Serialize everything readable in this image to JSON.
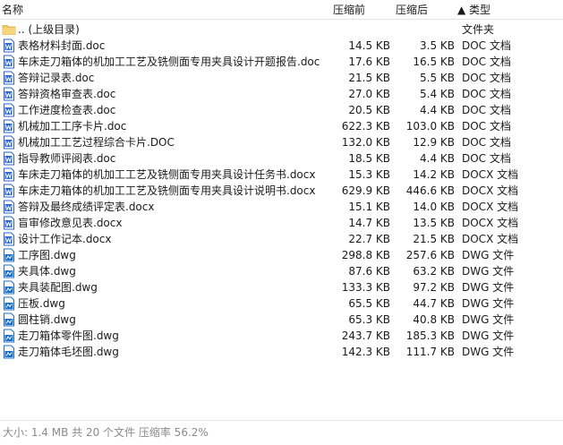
{
  "header": {
    "name": "名称",
    "size": "压缩前",
    "packed": "压缩后",
    "type": "▲ 类型"
  },
  "rows": [
    {
      "icon": "folder-icon",
      "name": ".. (上级目录)",
      "size": "",
      "packed": "",
      "type": "文件夹"
    },
    {
      "icon": "word-doc-icon",
      "name": "表格材料封面.doc",
      "size": "14.5 KB",
      "packed": "3.5 KB",
      "type": "DOC 文档"
    },
    {
      "icon": "word-doc-icon",
      "name": "车床走刀箱体的机加工工艺及铣侧面专用夹具设计开题报告.doc",
      "size": "17.6 KB",
      "packed": "16.5 KB",
      "type": "DOC 文档"
    },
    {
      "icon": "word-doc-icon",
      "name": "答辩记录表.doc",
      "size": "21.5 KB",
      "packed": "5.5 KB",
      "type": "DOC 文档"
    },
    {
      "icon": "word-doc-icon",
      "name": "答辩资格审查表.doc",
      "size": "27.0 KB",
      "packed": "5.4 KB",
      "type": "DOC 文档"
    },
    {
      "icon": "word-doc-icon",
      "name": "工作进度检查表.doc",
      "size": "20.5 KB",
      "packed": "4.4 KB",
      "type": "DOC 文档"
    },
    {
      "icon": "word-doc-icon",
      "name": "机械加工工序卡片.doc",
      "size": "622.3 KB",
      "packed": "103.0 KB",
      "type": "DOC 文档"
    },
    {
      "icon": "word-doc-icon",
      "name": "机械加工工艺过程综合卡片.DOC",
      "size": "132.0 KB",
      "packed": "12.9 KB",
      "type": "DOC 文档"
    },
    {
      "icon": "word-doc-icon",
      "name": "指导教师评阅表.doc",
      "size": "18.5 KB",
      "packed": "4.4 KB",
      "type": "DOC 文档"
    },
    {
      "icon": "word-docx-icon",
      "name": "车床走刀箱体的机加工工艺及铣侧面专用夹具设计任务书.docx",
      "size": "15.3 KB",
      "packed": "14.2 KB",
      "type": "DOCX 文档"
    },
    {
      "icon": "word-docx-icon",
      "name": "车床走刀箱体的机加工工艺及铣侧面专用夹具设计说明书.docx",
      "size": "629.9 KB",
      "packed": "446.6 KB",
      "type": "DOCX 文档"
    },
    {
      "icon": "word-docx-icon",
      "name": "答辩及最终成绩评定表.docx",
      "size": "15.1 KB",
      "packed": "14.0 KB",
      "type": "DOCX 文档"
    },
    {
      "icon": "word-docx-icon",
      "name": "盲审修改意见表.docx",
      "size": "14.7 KB",
      "packed": "13.5 KB",
      "type": "DOCX 文档"
    },
    {
      "icon": "word-docx-icon",
      "name": "设计工作记本.docx",
      "size": "22.7 KB",
      "packed": "21.5 KB",
      "type": "DOCX 文档"
    },
    {
      "icon": "dwg-file-icon",
      "name": "工序图.dwg",
      "size": "298.8 KB",
      "packed": "257.6 KB",
      "type": "DWG 文件"
    },
    {
      "icon": "dwg-file-icon",
      "name": "夹具体.dwg",
      "size": "87.6 KB",
      "packed": "63.2 KB",
      "type": "DWG 文件"
    },
    {
      "icon": "dwg-file-icon",
      "name": "夹具装配图.dwg",
      "size": "133.3 KB",
      "packed": "97.2 KB",
      "type": "DWG 文件"
    },
    {
      "icon": "dwg-file-icon",
      "name": "压板.dwg",
      "size": "65.5 KB",
      "packed": "44.7 KB",
      "type": "DWG 文件"
    },
    {
      "icon": "dwg-file-icon",
      "name": "圆柱销.dwg",
      "size": "65.3 KB",
      "packed": "40.8 KB",
      "type": "DWG 文件"
    },
    {
      "icon": "dwg-file-icon",
      "name": "走刀箱体零件图.dwg",
      "size": "243.7 KB",
      "packed": "185.3 KB",
      "type": "DWG 文件"
    },
    {
      "icon": "dwg-file-icon",
      "name": "走刀箱体毛坯图.dwg",
      "size": "142.3 KB",
      "packed": "111.7 KB",
      "type": "DWG 文件"
    }
  ],
  "status": {
    "text": "大小: 1.4 MB 共 20 个文件 压缩率 56.2%"
  },
  "colors": {
    "folder": "#f3c75f",
    "word": "#2b63c9",
    "dwg": "#1c6fc4"
  }
}
